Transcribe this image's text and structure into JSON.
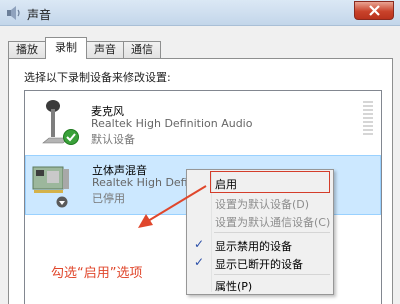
{
  "window": {
    "title": "声音"
  },
  "tabs": [
    {
      "label": "播放"
    },
    {
      "label": "录制",
      "active": true
    },
    {
      "label": "声音"
    },
    {
      "label": "通信"
    }
  ],
  "instruction": "选择以下录制设备来修改设置:",
  "devices": [
    {
      "name": "麦克风",
      "driver": "Realtek High Definition Audio",
      "status": "默认设备",
      "icon": "microphone-icon",
      "badge": "default-check-icon"
    },
    {
      "name": "立体声混音",
      "driver": "Realtek High Definition Audio",
      "status": "已停用",
      "icon": "sound-card-icon",
      "badge": "disabled-arrow-icon",
      "selected": true
    }
  ],
  "context_menu": {
    "items": [
      {
        "label": "启用",
        "enabled": true,
        "highlighted": true
      },
      {
        "label": "设置为默认设备(D)",
        "enabled": false
      },
      {
        "label": "设置为默认通信设备(C)",
        "enabled": false
      },
      {
        "label": "显示禁用的设备",
        "checked": true
      },
      {
        "label": "显示已断开的设备",
        "checked": true
      },
      {
        "label": "属性(P)",
        "enabled": true
      }
    ]
  },
  "annotation": {
    "text": "勾选“启用”选项",
    "color": "#e0472c"
  },
  "colors": {
    "selection": "#cce8ff",
    "highlight_box": "#d43d2a",
    "close_button": "#c9432b"
  }
}
